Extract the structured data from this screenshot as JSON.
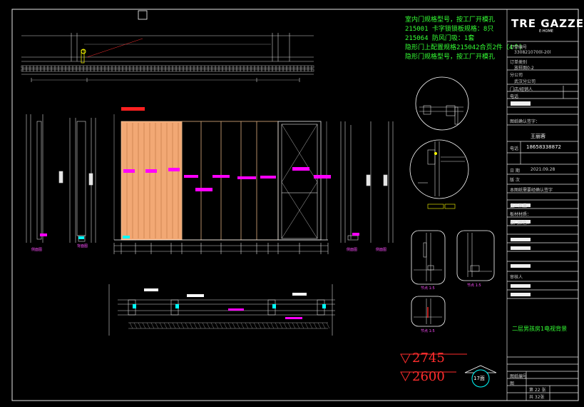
{
  "notes": [
    "室内门规格型号，按工厂开模孔",
    "215001 卡字锁锁板规格：8只",
    "215064 防风门吸：1套",
    "隐形门上配置规格215042合页2件（4个）",
    "隐形门规格型号，按工厂开模孔"
  ],
  "title_block": {
    "logo": "TRE GAZZE",
    "logo_sub": "E·HOME",
    "order_label": "订单编号",
    "order_value": "3308210700l-20l",
    "customer_label": "订单类别",
    "customer_value": "放样图0-2",
    "company_label": "分公司",
    "company_value": "武汉分公司",
    "store_label": "门店/经销人",
    "phone_label": "电话",
    "confirm_label": "图纸确认签字：",
    "designer_value": "王丽蓉",
    "tel_label": "电话",
    "tel_value": "18658338872",
    "date_label": "日 期",
    "date_value": "2021.09.28",
    "version_label": "版 次",
    "notice_value": "本图纸需要经确认签字",
    "production_label": "生产数量：",
    "material_label": "板材材质：",
    "color_label": "板门颜色：",
    "audit_label": "审核人",
    "project_name": "二层男孩房1电视背景",
    "drawing_no_label": "图纸编号",
    "drawing_label": "图",
    "page_label": "第 22 张",
    "total_label": "共 32张"
  },
  "levels": [
    "2745",
    "2600"
  ],
  "section_badge": "17面",
  "view_labels": {
    "left_side": "侧面图",
    "left_side_2": "背面图",
    "right_side": "侧面图",
    "right_side_2": "侧面图"
  },
  "detail_labels": [
    "节点 1:5",
    "节点 1:5",
    "节点 1:5"
  ],
  "colors": {
    "background": "#000000",
    "notes": "#34ff34",
    "level": "#ff2d2d",
    "panel": "#f2a874",
    "magenta": "#ff00ff",
    "cyan": "#00ffff"
  }
}
